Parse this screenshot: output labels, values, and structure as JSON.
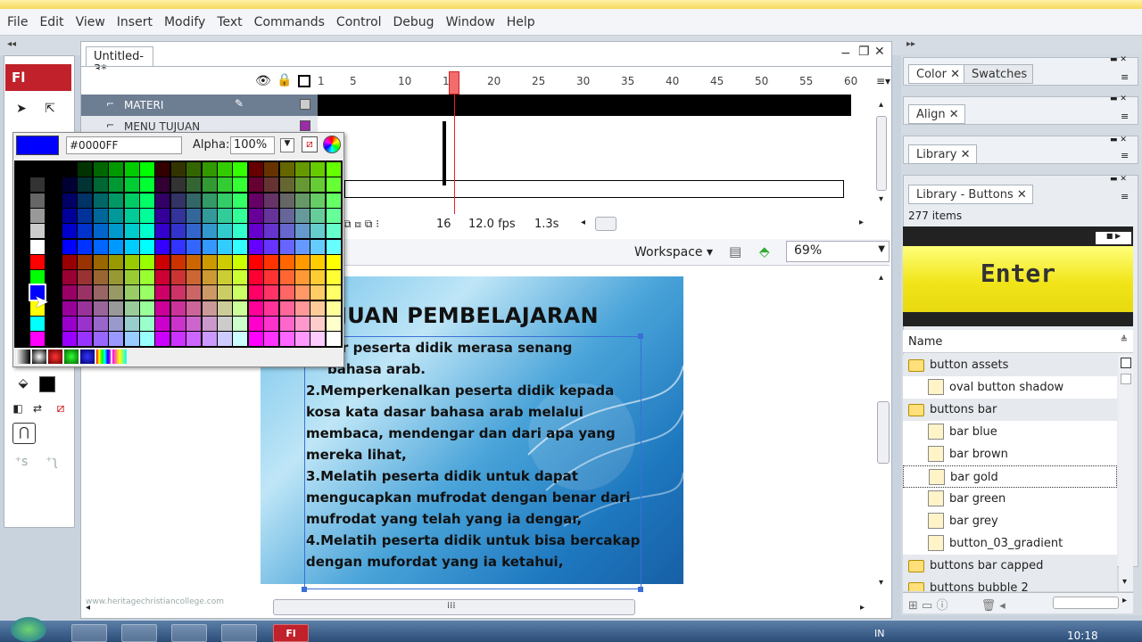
{
  "menu": [
    "File",
    "Edit",
    "View",
    "Insert",
    "Modify",
    "Text",
    "Commands",
    "Control",
    "Debug",
    "Window",
    "Help"
  ],
  "tools": {
    "logo": "Fl"
  },
  "document": {
    "tab": "Untitled-3*"
  },
  "timeline": {
    "ruler": [
      "1",
      "5",
      "10",
      "15",
      "20",
      "25",
      "30",
      "35",
      "40",
      "45",
      "50",
      "55",
      "60"
    ],
    "layers": [
      {
        "name": "MATERI",
        "selected": true
      },
      {
        "name": "MENU TUJUAN",
        "selected": false
      }
    ],
    "current_frame": "16",
    "fps": "12.0 fps",
    "time": "1.3s",
    "playhead_frame": 16
  },
  "editbar": {
    "workspace": "Workspace",
    "zoom": "69%"
  },
  "stage": {
    "title": "JUAN PEMBELAJARAN",
    "lines": [
      "r peserta didik merasa senang",
      "bahasa arab.",
      "2.Memperkenalkan peserta didik kepada",
      "kosa kata dasar bahasa arab melalui",
      "membaca, mendengar dan dari apa yang",
      "mereka lihat,",
      "3.Melatih peserta didik untuk dapat",
      "mengucapkan mufrodat dengan benar dari",
      "mufrodat yang telah yang ia dengar,",
      "4.Melatih peserta didik untuk bisa bercakap",
      "dengan mufordat yang ia ketahui,"
    ]
  },
  "swatches_popup": {
    "hex": "#0000FF",
    "alpha_label": "Alpha:",
    "alpha_value": "100%",
    "selected_color": "#0000FF"
  },
  "panels": {
    "color_tab": "Color",
    "swatches_tab": "Swatches",
    "align_tab": "Align",
    "library_tab": "Library",
    "library_buttons_tab": "Library - Buttons",
    "item_count": "277 items",
    "preview_label": "Enter",
    "name_header": "Name",
    "items": [
      {
        "label": "button assets",
        "type": "folder",
        "indent": 0
      },
      {
        "label": "oval button shadow",
        "type": "graphic",
        "indent": 1
      },
      {
        "label": "buttons bar",
        "type": "folder",
        "indent": 0
      },
      {
        "label": "bar blue",
        "type": "button",
        "indent": 1
      },
      {
        "label": "bar brown",
        "type": "button",
        "indent": 1
      },
      {
        "label": "bar gold",
        "type": "button",
        "indent": 1,
        "selected": true
      },
      {
        "label": "bar green",
        "type": "button",
        "indent": 1
      },
      {
        "label": "bar grey",
        "type": "button",
        "indent": 1
      },
      {
        "label": "button_03_gradient",
        "type": "graphic",
        "indent": 1
      },
      {
        "label": "buttons bar capped",
        "type": "folder",
        "indent": 0
      },
      {
        "label": "buttons bubble 2",
        "type": "folder",
        "indent": 0
      }
    ]
  },
  "taskbar": {
    "fl": "Fl",
    "lang": "IN",
    "time": "10:18"
  },
  "watermark": "www.heritagechristiancollege.com"
}
